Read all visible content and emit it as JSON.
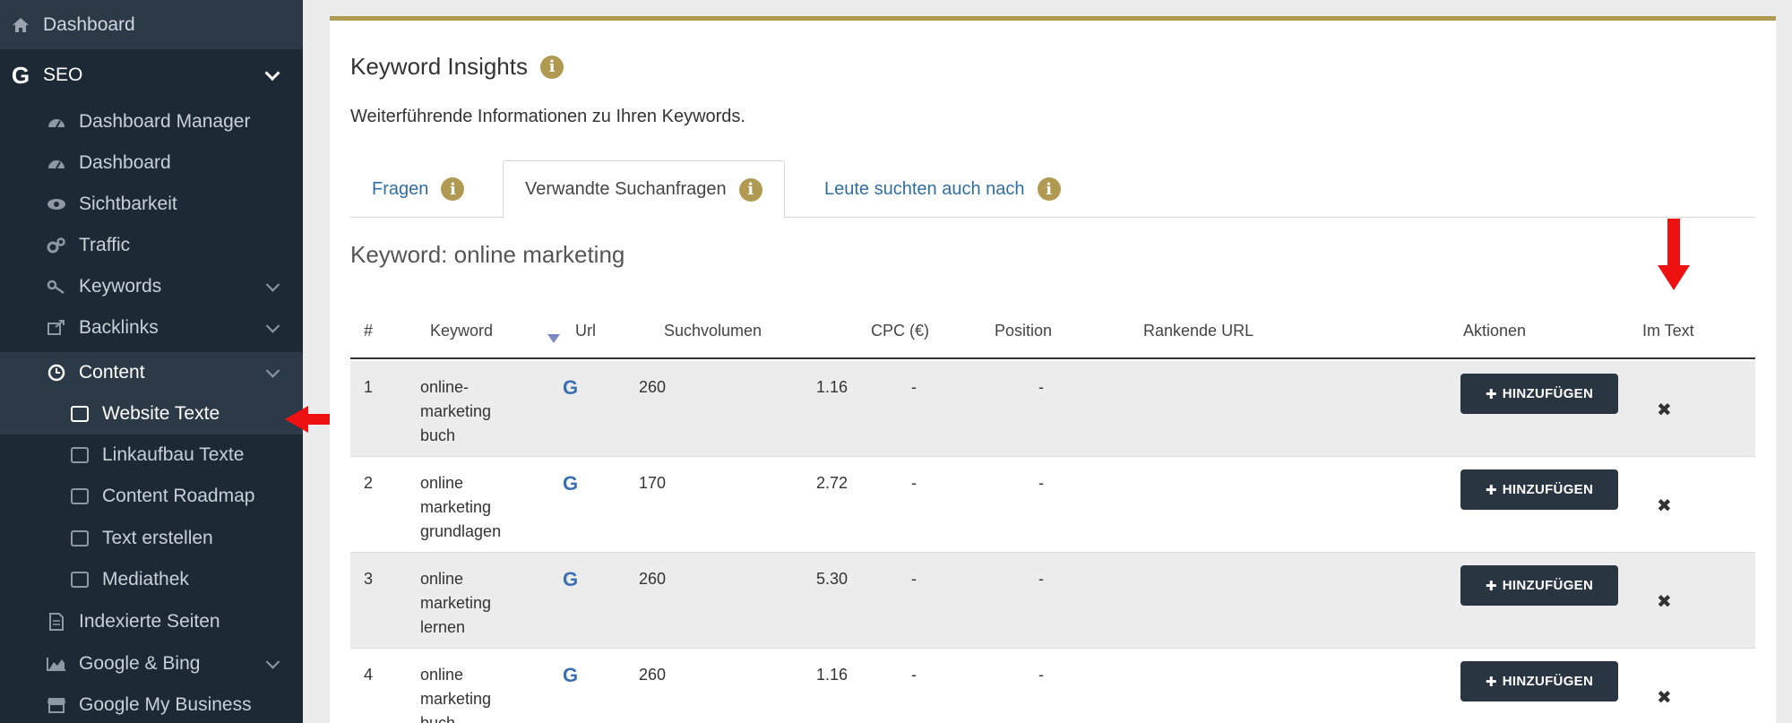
{
  "sidebar": {
    "dashboard": "Dashboard",
    "seo": "SEO",
    "items": [
      {
        "label": "Dashboard Manager",
        "icon": "dashboard-gauge-icon"
      },
      {
        "label": "Dashboard",
        "icon": "dashboard-gauge-icon"
      },
      {
        "label": "Sichtbarkeit",
        "icon": "eye-icon"
      },
      {
        "label": "Traffic",
        "icon": "gears-icon"
      },
      {
        "label": "Keywords",
        "icon": "key-icon"
      },
      {
        "label": "Backlinks",
        "icon": "external-link-icon"
      },
      {
        "label": "Content",
        "icon": "clock-icon"
      },
      {
        "label": "Website Texte",
        "icon": "copy-icon"
      },
      {
        "label": "Linkaufbau Texte",
        "icon": "copy-icon"
      },
      {
        "label": "Content Roadmap",
        "icon": "copy-icon"
      },
      {
        "label": "Text erstellen",
        "icon": "copy-icon"
      },
      {
        "label": "Mediathek",
        "icon": "copy-icon"
      },
      {
        "label": "Indexierte Seiten",
        "icon": "document-icon"
      },
      {
        "label": "Google & Bing",
        "icon": "area-chart-icon"
      },
      {
        "label": "Google My Business",
        "icon": "store-icon"
      }
    ]
  },
  "main": {
    "title": "Keyword Insights",
    "subtitle": "Weiterführende Informationen zu Ihren Keywords.",
    "tabs": [
      {
        "label": "Fragen"
      },
      {
        "label": "Verwandte Suchanfragen"
      },
      {
        "label": "Leute suchten auch nach"
      }
    ],
    "keyword_heading": "Keyword: online marketing",
    "columns": [
      "#",
      "Keyword",
      "Url",
      "Suchvolumen",
      "CPC (€)",
      "Position",
      "Rankende URL",
      "Aktionen",
      "Im Text"
    ],
    "add_label": "HINZUFÜGEN",
    "rows": [
      {
        "num": "1",
        "keyword": "online-\nmarketing\nbuch",
        "url_icon": "G",
        "volume": "260",
        "cpc": "1.16",
        "pos1": "-",
        "pos2": "-"
      },
      {
        "num": "2",
        "keyword": "online\nmarketing\ngrundlagen",
        "url_icon": "G",
        "volume": "170",
        "cpc": "2.72",
        "pos1": "-",
        "pos2": "-"
      },
      {
        "num": "3",
        "keyword": "online\nmarketing\nlernen",
        "url_icon": "G",
        "volume": "260",
        "cpc": "5.30",
        "pos1": "-",
        "pos2": "-"
      },
      {
        "num": "4",
        "keyword": "online\nmarketing\nbuch",
        "url_icon": "G",
        "volume": "260",
        "cpc": "1.16",
        "pos1": "-",
        "pos2": "-"
      }
    ]
  },
  "colors": {
    "sidebar_bg": "#1d2a36",
    "accent": "#b09a52",
    "button_bg": "#2a3542",
    "arrow": "#ee1111"
  }
}
